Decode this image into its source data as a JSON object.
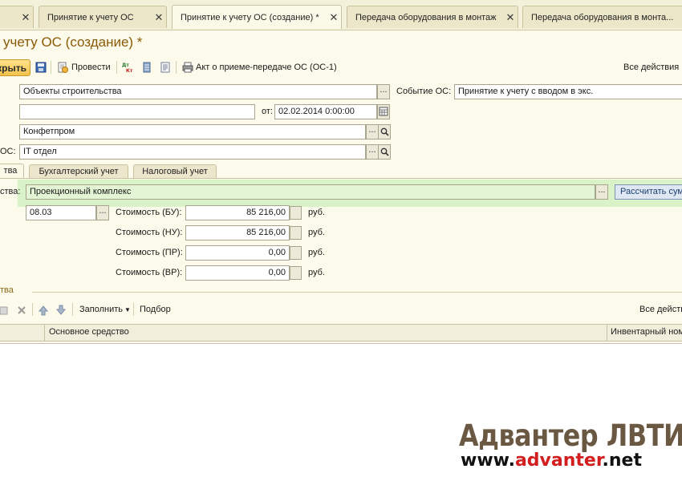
{
  "tabs": [
    {
      "label": "",
      "active": false
    },
    {
      "label": "Принятие к учету ОС",
      "active": false
    },
    {
      "label": "Принятие к учету ОС (создание) *",
      "active": true
    },
    {
      "label": "Передача оборудования в монтаж",
      "active": false
    },
    {
      "label": "Передача оборудования в монта...",
      "active": false
    }
  ],
  "title": "учету ОС (создание) *",
  "toolbar": {
    "close_label": "крыть",
    "post_label": "Провести",
    "print_label": "Акт о приеме-передаче ОС (ОС-1)",
    "all_actions": "Все действия"
  },
  "form": {
    "construction_objects": "Объекты строительства",
    "event_label": "Событие ОС:",
    "event_value": "Принятие к учету с вводом в экс.",
    "number_value": "",
    "date_label": "от:",
    "date_value": "02.02.2014  0:00:00",
    "organization": "Конфетпром",
    "mol_label": "ОС:",
    "department": "IT отдел"
  },
  "inner_tabs": [
    {
      "label": "тва",
      "active": true
    },
    {
      "label": "Бухгалтерский учет",
      "active": false
    },
    {
      "label": "Налоговый учет",
      "active": false
    }
  ],
  "object": {
    "label": "ства:",
    "value": "Проекционный комплекс",
    "calc_button": "Рассчитать сум"
  },
  "account": {
    "value": "08.03"
  },
  "costs": [
    {
      "label": "Стоимость (БУ):",
      "value": "85 216,00",
      "unit": "руб."
    },
    {
      "label": "Стоимость (НУ):",
      "value": "85 216,00",
      "unit": "руб."
    },
    {
      "label": "Стоимость (ПР):",
      "value": "0,00",
      "unit": "руб."
    },
    {
      "label": "Стоимость (ВР):",
      "value": "0,00",
      "unit": "руб."
    }
  ],
  "section_label": "тва",
  "table_toolbar": {
    "fill_label": "Заполнить",
    "select_label": "Подбор",
    "all_actions": "Все действ"
  },
  "grid": {
    "columns": [
      "Основное средство",
      "Инвентарный ном"
    ]
  },
  "watermark": {
    "title": "Адвантер ЛВТИ",
    "url_prefix": "www.",
    "url_accent": "advanter",
    "url_suffix": ".net"
  }
}
